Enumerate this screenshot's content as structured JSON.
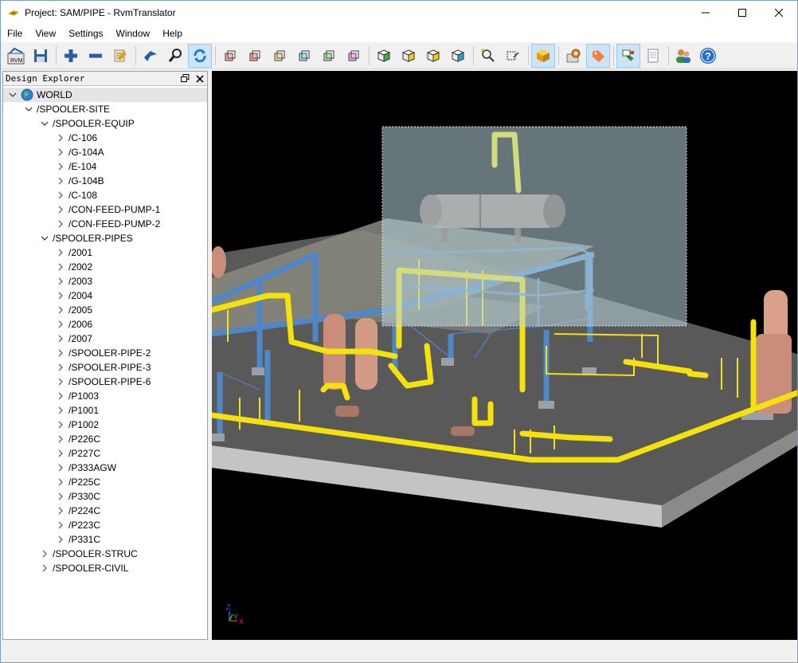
{
  "window": {
    "title": "Project: SAM/PIPE - RvmTranslator"
  },
  "menu": [
    "File",
    "View",
    "Settings",
    "Window",
    "Help"
  ],
  "toolbar": {
    "buttons": [
      {
        "name": "open-rvm",
        "icon": "open-rvm-icon",
        "label": "RVM"
      },
      {
        "name": "save",
        "icon": "save-icon"
      },
      {
        "name": "expand",
        "icon": "plus-icon"
      },
      {
        "name": "collapse",
        "icon": "minus-icon"
      },
      {
        "name": "properties",
        "icon": "edit-list-icon"
      },
      {
        "name": "fly",
        "icon": "fly-icon"
      },
      {
        "name": "search",
        "icon": "search-icon"
      },
      {
        "name": "rotate",
        "icon": "rotate-icon",
        "active": true
      },
      {
        "name": "view-front",
        "icon": "cube-front-icon"
      },
      {
        "name": "view-back",
        "icon": "cube-back-icon"
      },
      {
        "name": "view-left",
        "icon": "cube-left-icon"
      },
      {
        "name": "view-right",
        "icon": "cube-right-icon"
      },
      {
        "name": "view-top",
        "icon": "cube-top-icon"
      },
      {
        "name": "view-bottom",
        "icon": "cube-bottom-icon"
      },
      {
        "name": "iso-1",
        "icon": "iso-cube-1-icon"
      },
      {
        "name": "iso-2",
        "icon": "iso-cube-2-icon"
      },
      {
        "name": "iso-3",
        "icon": "iso-cube-3-icon"
      },
      {
        "name": "iso-4",
        "icon": "iso-cube-4-icon"
      },
      {
        "name": "zoom-fit",
        "icon": "zoom-fit-icon"
      },
      {
        "name": "zoom-window",
        "icon": "zoom-window-icon"
      },
      {
        "name": "shaded",
        "icon": "shaded-cube-icon",
        "active": true
      },
      {
        "name": "settings",
        "icon": "settings-icon"
      },
      {
        "name": "tag",
        "icon": "tag-icon",
        "active": true
      },
      {
        "name": "clip",
        "icon": "clip-icon",
        "active": true
      },
      {
        "name": "report",
        "icon": "report-icon"
      },
      {
        "name": "users",
        "icon": "users-icon"
      },
      {
        "name": "help",
        "icon": "help-icon"
      }
    ]
  },
  "explorer": {
    "title": "Design Explorer",
    "rows": [
      {
        "label": "WORLD",
        "level": 0,
        "chev": "down",
        "icon": "globe-icon"
      },
      {
        "label": "/SPOOLER-SITE",
        "level": 1,
        "chev": "down"
      },
      {
        "label": "/SPOOLER-EQUIP",
        "level": 2,
        "chev": "down"
      },
      {
        "label": "/C-106",
        "level": 3,
        "chev": "right"
      },
      {
        "label": "/G-104A",
        "level": 3,
        "chev": "right"
      },
      {
        "label": "/E-104",
        "level": 3,
        "chev": "right"
      },
      {
        "label": "/G-104B",
        "level": 3,
        "chev": "right"
      },
      {
        "label": "/C-108",
        "level": 3,
        "chev": "right"
      },
      {
        "label": "/CON-FEED-PUMP-1",
        "level": 3,
        "chev": "right"
      },
      {
        "label": "/CON-FEED-PUMP-2",
        "level": 3,
        "chev": "right"
      },
      {
        "label": "/SPOOLER-PIPES",
        "level": 2,
        "chev": "down"
      },
      {
        "label": "/2001",
        "level": 3,
        "chev": "right"
      },
      {
        "label": "/2002",
        "level": 3,
        "chev": "right"
      },
      {
        "label": "/2003",
        "level": 3,
        "chev": "right"
      },
      {
        "label": "/2004",
        "level": 3,
        "chev": "right"
      },
      {
        "label": "/2005",
        "level": 3,
        "chev": "right"
      },
      {
        "label": "/2006",
        "level": 3,
        "chev": "right"
      },
      {
        "label": "/2007",
        "level": 3,
        "chev": "right"
      },
      {
        "label": "/SPOOLER-PIPE-2",
        "level": 3,
        "chev": "right"
      },
      {
        "label": "/SPOOLER-PIPE-3",
        "level": 3,
        "chev": "right"
      },
      {
        "label": "/SPOOLER-PIPE-6",
        "level": 3,
        "chev": "right"
      },
      {
        "label": "/P1003",
        "level": 3,
        "chev": "right"
      },
      {
        "label": "/P1001",
        "level": 3,
        "chev": "right"
      },
      {
        "label": "/P1002",
        "level": 3,
        "chev": "right"
      },
      {
        "label": "/P226C",
        "level": 3,
        "chev": "right"
      },
      {
        "label": "/P227C",
        "level": 3,
        "chev": "right"
      },
      {
        "label": "/P333AGW",
        "level": 3,
        "chev": "right"
      },
      {
        "label": "/P225C",
        "level": 3,
        "chev": "right"
      },
      {
        "label": "/P330C",
        "level": 3,
        "chev": "right"
      },
      {
        "label": "/P224C",
        "level": 3,
        "chev": "right"
      },
      {
        "label": "/P223C",
        "level": 3,
        "chev": "right"
      },
      {
        "label": "/P331C",
        "level": 3,
        "chev": "right"
      },
      {
        "label": "/SPOOLER-STRUC",
        "level": 2,
        "chev": "right"
      },
      {
        "label": "/SPOOLER-CIVIL",
        "level": 2,
        "chev": "right"
      }
    ]
  },
  "viewport": {
    "axis": {
      "z": "Z",
      "y": "Y",
      "x": "X"
    },
    "colors": {
      "background": "#000000",
      "pipe": "#f5e20a",
      "steel": "#4f86c6",
      "vessel": "#c98d7a",
      "floor": "#555555",
      "slab": "#b9b9b9"
    }
  }
}
